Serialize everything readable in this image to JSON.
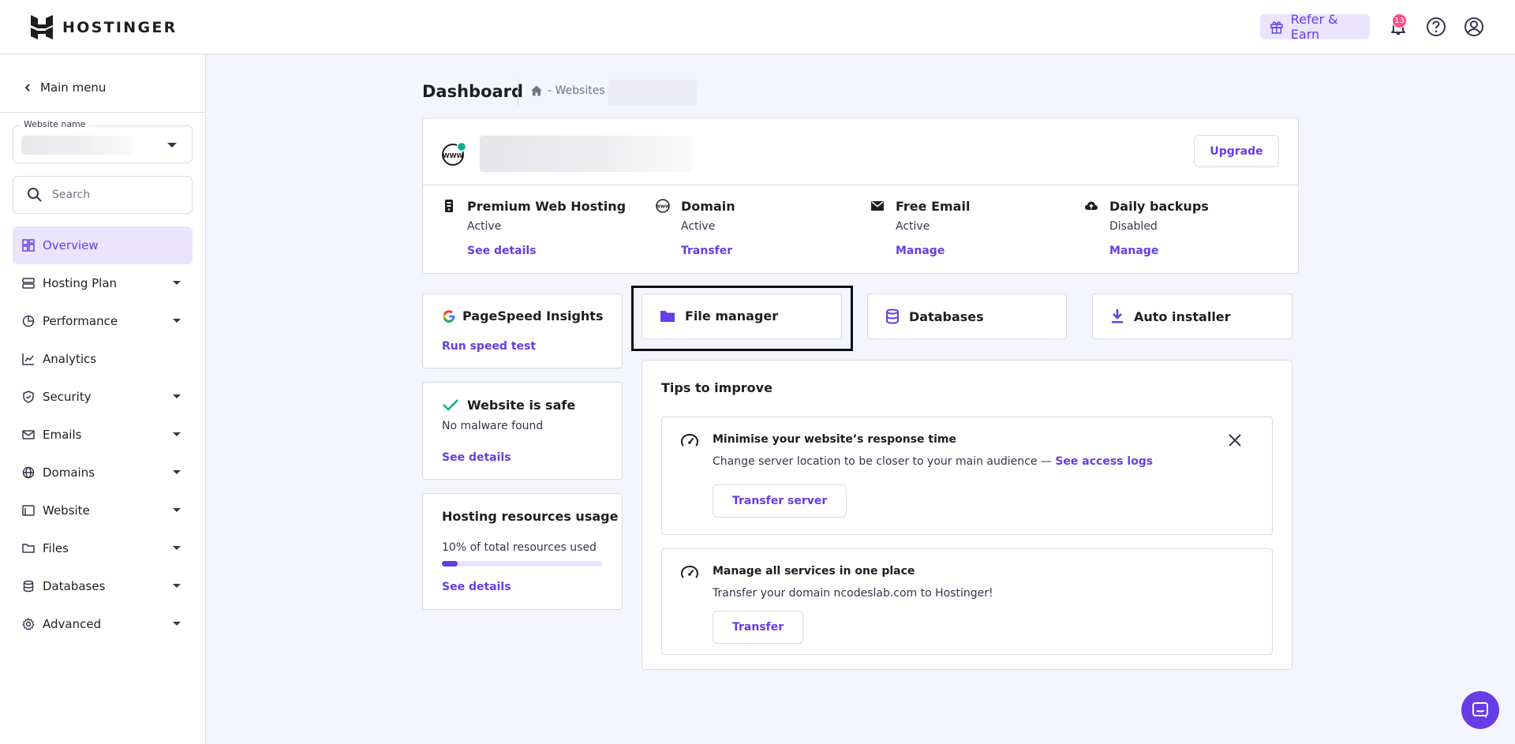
{
  "brand": {
    "name": "HOSTINGER"
  },
  "header": {
    "refer_label": "Refer & Earn",
    "notification_count": "13",
    "icons": [
      "gift-icon",
      "bell-icon",
      "help-icon",
      "account-icon"
    ]
  },
  "sidebar": {
    "main_menu": "Main menu",
    "website_select_label": "Website name",
    "search_placeholder": "Search",
    "items": [
      {
        "label": "Overview",
        "icon": "overview-icon",
        "active": true,
        "expandable": false
      },
      {
        "label": "Hosting Plan",
        "icon": "server-icon",
        "expandable": true
      },
      {
        "label": "Performance",
        "icon": "performance-icon",
        "expandable": true
      },
      {
        "label": "Analytics",
        "icon": "analytics-icon",
        "expandable": false
      },
      {
        "label": "Security",
        "icon": "shield-icon",
        "expandable": true
      },
      {
        "label": "Emails",
        "icon": "mail-icon",
        "expandable": true
      },
      {
        "label": "Domains",
        "icon": "globe-icon",
        "expandable": true
      },
      {
        "label": "Website",
        "icon": "browser-icon",
        "expandable": true
      },
      {
        "label": "Files",
        "icon": "folder-icon",
        "expandable": true
      },
      {
        "label": "Databases",
        "icon": "database-icon",
        "expandable": true
      },
      {
        "label": "Advanced",
        "icon": "gear-icon",
        "expandable": true
      }
    ]
  },
  "page": {
    "title": "Dashboard",
    "breadcrumb": "- Websites"
  },
  "site_card": {
    "upgrade_label": "Upgrade",
    "services": [
      {
        "title": "Premium Web Hosting",
        "status": "Active",
        "link": "See details",
        "icon": "hosting-icon"
      },
      {
        "title": "Domain",
        "status": "Active",
        "link": "Transfer",
        "icon": "www-icon"
      },
      {
        "title": "Free Email",
        "status": "Active",
        "link": "Manage",
        "icon": "mail-icon"
      },
      {
        "title": "Daily backups",
        "status": "Disabled",
        "link": "Manage",
        "icon": "cloud-backup-icon"
      }
    ]
  },
  "quick_actions": {
    "pagespeed": {
      "title": "PageSpeed Insights",
      "link": "Run speed test"
    },
    "file_manager": "File manager",
    "databases": "Databases",
    "auto_installer": "Auto installer"
  },
  "security_card": {
    "title": "Website is safe",
    "subtitle": "No malware found",
    "link": "See details"
  },
  "resources_card": {
    "title": "Hosting resources usage",
    "usage_text": "10% of total resources used",
    "usage_fraction": 0.1,
    "link": "See details"
  },
  "tips": {
    "title": "Tips to improve",
    "items": [
      {
        "title": "Minimise your website’s response time",
        "text": "Change server location to be closer to your main audience — ",
        "link": "See access logs",
        "button": "Transfer server"
      },
      {
        "title": "Manage all services in one place",
        "text": "Transfer your domain ncodeslab.com to Hostinger!",
        "button": "Transfer"
      }
    ]
  },
  "colors": {
    "accent": "#673de6",
    "accent_light": "#ebe4ff",
    "success": "#00b090",
    "text": "#1d1e20",
    "muted": "#727586"
  }
}
